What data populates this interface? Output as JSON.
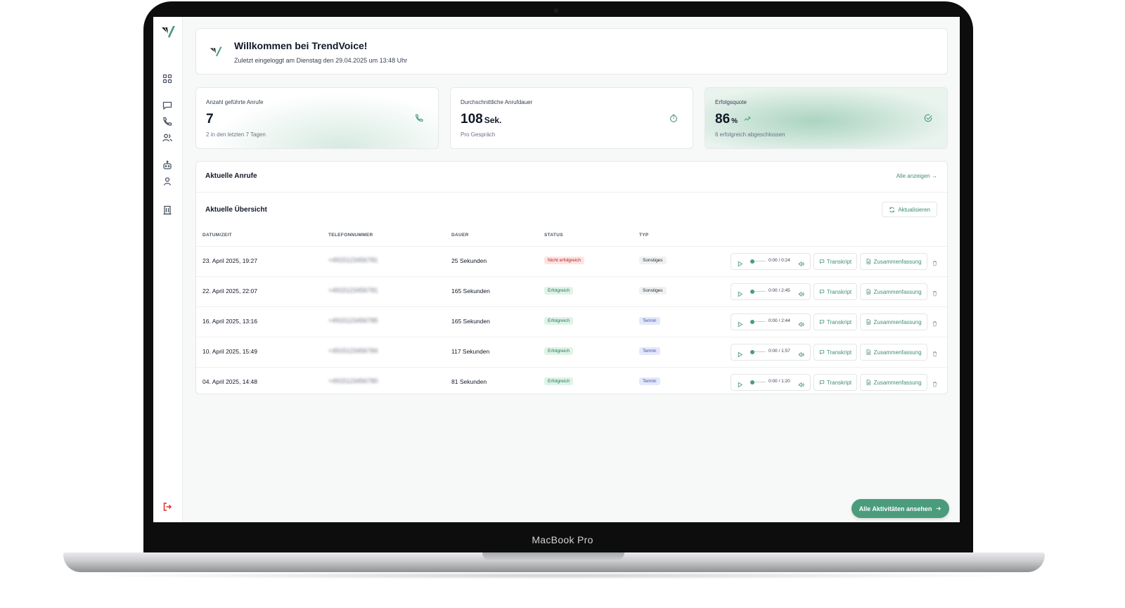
{
  "device": {
    "brand_label": "MacBook Pro"
  },
  "sidebar": {
    "items": [
      {
        "name": "dashboard",
        "icon": "grid-icon"
      },
      {
        "name": "messages",
        "icon": "message-icon"
      },
      {
        "name": "calls",
        "icon": "phone-icon"
      },
      {
        "name": "contacts",
        "icon": "users-icon"
      },
      {
        "name": "assistant",
        "icon": "bot-icon"
      },
      {
        "name": "profile",
        "icon": "user-icon"
      },
      {
        "name": "company",
        "icon": "building-icon"
      }
    ],
    "logout_icon": "logout-icon"
  },
  "welcome": {
    "title": "Willkommen bei TrendVoice!",
    "subtitle": "Zuletzt eingeloggt am Dienstag den 29.04.2025 um 13:48 Uhr"
  },
  "stats": [
    {
      "label": "Anzahl geführte Anrufe",
      "value": "7",
      "unit": "",
      "note": "2 in den letzten 7 Tagen",
      "icon": "phone-icon"
    },
    {
      "label": "Durchschnittliche Anrufdauer",
      "value": "108",
      "unit": "Sek.",
      "note": "Pro Gespräch",
      "icon": "timer-icon"
    },
    {
      "label": "Erfolgsquote",
      "value": "86",
      "unit": "%",
      "note": "6 erfolgreich abgeschlossen",
      "icon": "check-circle-icon",
      "trend_icon": "trending-up-icon"
    }
  ],
  "calls": {
    "title": "Aktuelle Anrufe",
    "view_all": "Alle anzeigen",
    "overview_title": "Aktuelle Übersicht",
    "refresh": "Aktualisieren",
    "columns": [
      "DATUM/ZEIT",
      "TELEFONNUMMER",
      "DAUER",
      "STATUS",
      "TYP"
    ],
    "transcript_label": "Transkript",
    "summary_label": "Zusammenfassung",
    "rows": [
      {
        "date": "23. April 2025, 19:27",
        "phone": "+4915123456781",
        "duration": "25 Sekunden",
        "status": "Nicht erfolgreich",
        "status_kind": "fail",
        "type": "Sonstiges",
        "type_kind": "other",
        "time": "0:00 / 0:24"
      },
      {
        "date": "22. April 2025, 22:07",
        "phone": "+4915123456781",
        "duration": "165 Sekunden",
        "status": "Erfolgreich",
        "status_kind": "ok",
        "type": "Sonstiges",
        "type_kind": "other",
        "time": "0:00 / 2:45"
      },
      {
        "date": "16. April 2025, 13:16",
        "phone": "+4915123456785",
        "duration": "165 Sekunden",
        "status": "Erfolgreich",
        "status_kind": "ok",
        "type": "Termin",
        "type_kind": "term",
        "time": "0:00 / 2:44"
      },
      {
        "date": "10. April 2025, 15:49",
        "phone": "+4915123456784",
        "duration": "117 Sekunden",
        "status": "Erfolgreich",
        "status_kind": "ok",
        "type": "Termin",
        "type_kind": "term",
        "time": "0:00 / 1:57"
      },
      {
        "date": "04. April 2025, 14:48",
        "phone": "+4915123456780",
        "duration": "81 Sekunden",
        "status": "Erfolgreich",
        "status_kind": "ok",
        "type": "Termin",
        "type_kind": "term",
        "time": "0:00 / 1:20"
      }
    ]
  },
  "cta": {
    "label": "Alle Aktivitäten ansehen"
  },
  "colors": {
    "accent": "#4a9c7c",
    "fail": "#b91c1c",
    "term": "#3b4fa8"
  }
}
